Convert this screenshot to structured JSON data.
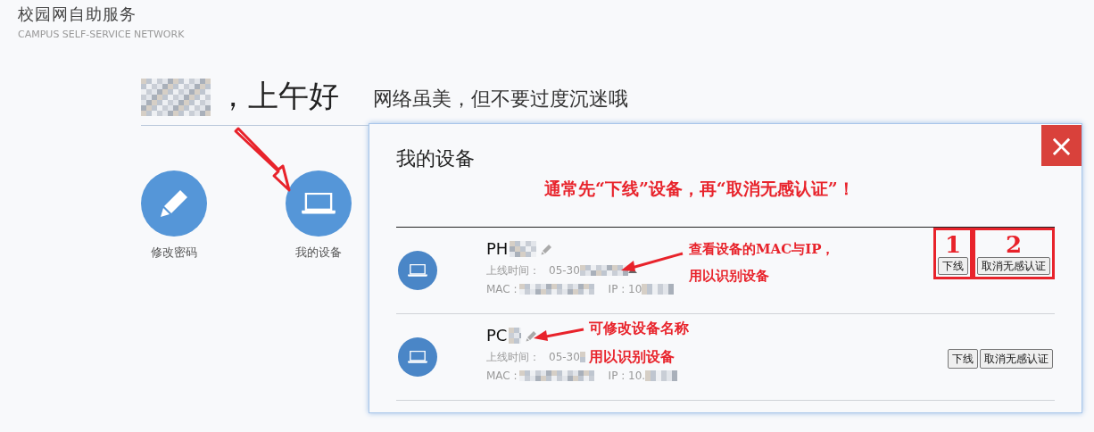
{
  "header": {
    "title": "校园网自助服务",
    "subtitle": "CAMPUS  SELF-SERVICE NETWORK"
  },
  "greeting": {
    "text": "，上午好",
    "slogan": "网络虽美，但不要过度沉迷哦"
  },
  "shortcuts": [
    {
      "kind": "pencil",
      "label": "修改密码"
    },
    {
      "kind": "laptop",
      "label": "我的设备"
    }
  ],
  "dialog": {
    "title": "我的设备",
    "close": "×",
    "devices": [
      {
        "name": "PH",
        "time_label": "上线时间：",
        "time": "05-30",
        "mac": "MAC :",
        "ip": "IP : 10",
        "buttons": [
          "下线",
          "取消无感认证"
        ]
      },
      {
        "name": "PC",
        "time_label": "上线时间：",
        "time": "05-30",
        "mac": "MAC :",
        "ip": "IP : 10.",
        "buttons": [
          "下线",
          "取消无感认证"
        ]
      }
    ]
  },
  "annotations": {
    "tip": "通常先“下线”设备，再“取消无感认证”！",
    "mac_note": [
      "查看设备的MAC与IP，",
      "用以识别设备"
    ],
    "name_note": [
      "可修改设备名称",
      "用以识别设备"
    ],
    "steps": [
      "1",
      "2"
    ]
  }
}
